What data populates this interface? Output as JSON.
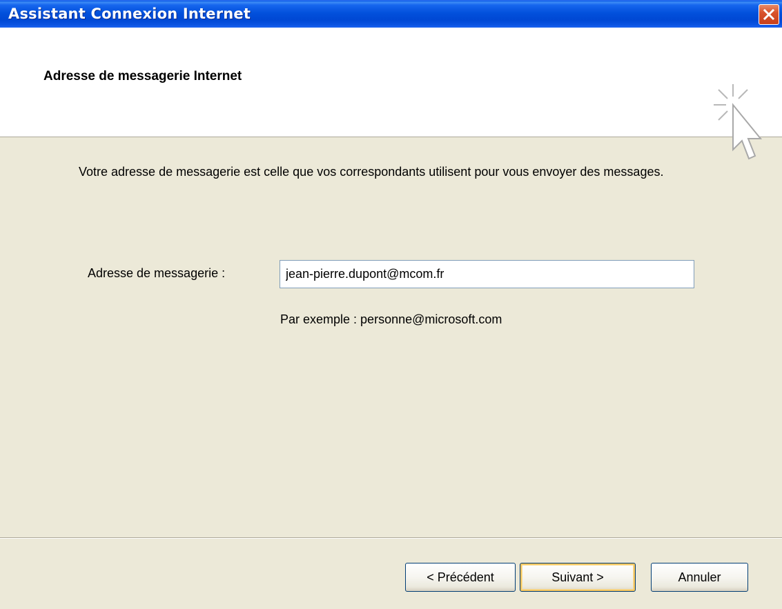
{
  "window": {
    "title": "Assistant Connexion Internet"
  },
  "header": {
    "title": "Adresse de messagerie Internet",
    "icon": "cursor-sparkle-icon"
  },
  "body": {
    "description": "Votre adresse de messagerie est celle que vos correspondants utilisent pour vous envoyer des messages.",
    "email_label": "Adresse de messagerie :",
    "email_value": "jean-pierre.dupont@mcom.fr",
    "example_text": "Par exemple : personne@microsoft.com"
  },
  "buttons": {
    "back": "< Précédent",
    "next": "Suivant >",
    "cancel": "Annuler"
  },
  "colors": {
    "titlebar": "#0251dc",
    "close": "#d9532c",
    "dialog_bg": "#ece9d8",
    "default_button_highlight": "#f5c660"
  }
}
